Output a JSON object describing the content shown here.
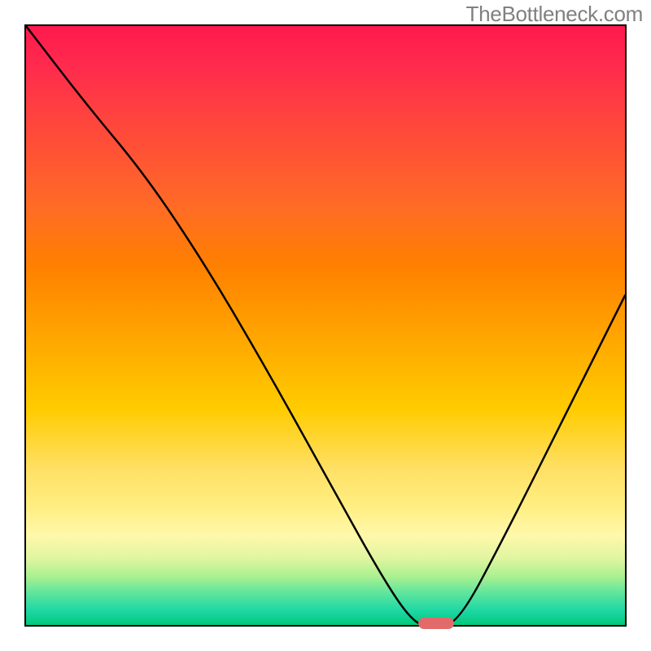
{
  "watermark": "TheBottleneck.com",
  "colors": {
    "watermark_text": "#808080",
    "curve_stroke": "#000000",
    "marker_fill": "#e26a6a",
    "border": "#000000"
  },
  "chart_data": {
    "type": "line",
    "title": "",
    "xlabel": "",
    "ylabel": "",
    "xlim": [
      0,
      100
    ],
    "ylim": [
      0,
      100
    ],
    "background": "vertical rainbow gradient (red top → green bottom)",
    "series": [
      {
        "name": "curve",
        "x": [
          0,
          10,
          20,
          30,
          40,
          50,
          60,
          65,
          68,
          72,
          80,
          90,
          100
        ],
        "values": [
          100,
          87,
          75,
          60,
          43,
          25,
          7,
          0,
          0,
          0,
          15,
          35,
          55
        ]
      }
    ],
    "annotations": [
      {
        "name": "min-marker",
        "type": "pill",
        "x_center": 68.5,
        "y": 0,
        "width_pct": 6.0
      }
    ]
  }
}
